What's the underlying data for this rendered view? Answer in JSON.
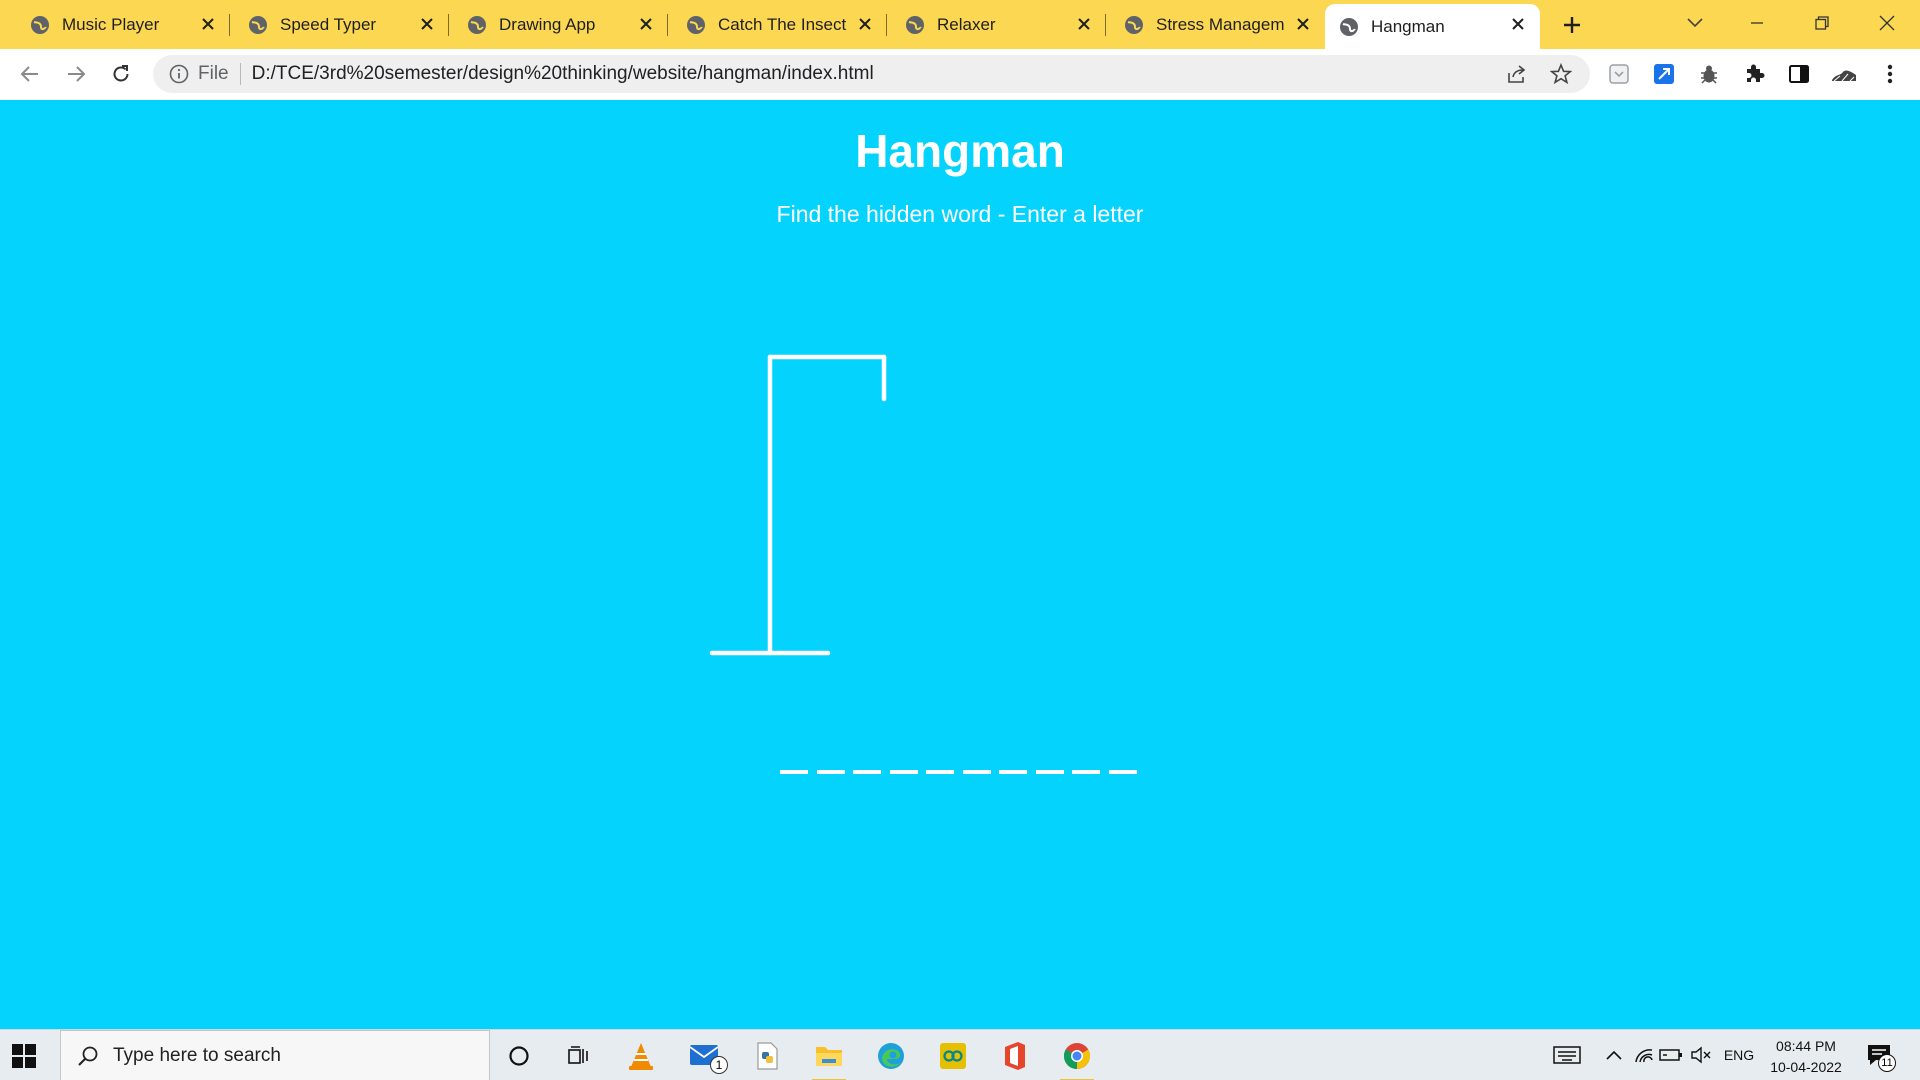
{
  "browser": {
    "tabs": [
      {
        "label": "Music Player",
        "active": false
      },
      {
        "label": "Speed Typer",
        "active": false
      },
      {
        "label": "Drawing App",
        "active": false
      },
      {
        "label": "Catch The Insect",
        "active": false
      },
      {
        "label": "Relaxer",
        "active": false
      },
      {
        "label": "Stress Management",
        "active": false
      },
      {
        "label": "Hangman",
        "active": true
      }
    ],
    "address": {
      "scheme_label": "File",
      "url": "D:/TCE/3rd%20semester/design%20thinking/website/hangman/index.html"
    }
  },
  "page": {
    "title": "Hangman",
    "subtitle": "Find the hidden word - Enter a letter",
    "word_length": 10,
    "background_color": "#04d3fe"
  },
  "taskbar": {
    "search_placeholder": "Type here to search",
    "mail_badge": "1",
    "language": "ENG",
    "time": "08:44 PM",
    "date": "10-04-2022",
    "notification_count": "11"
  }
}
